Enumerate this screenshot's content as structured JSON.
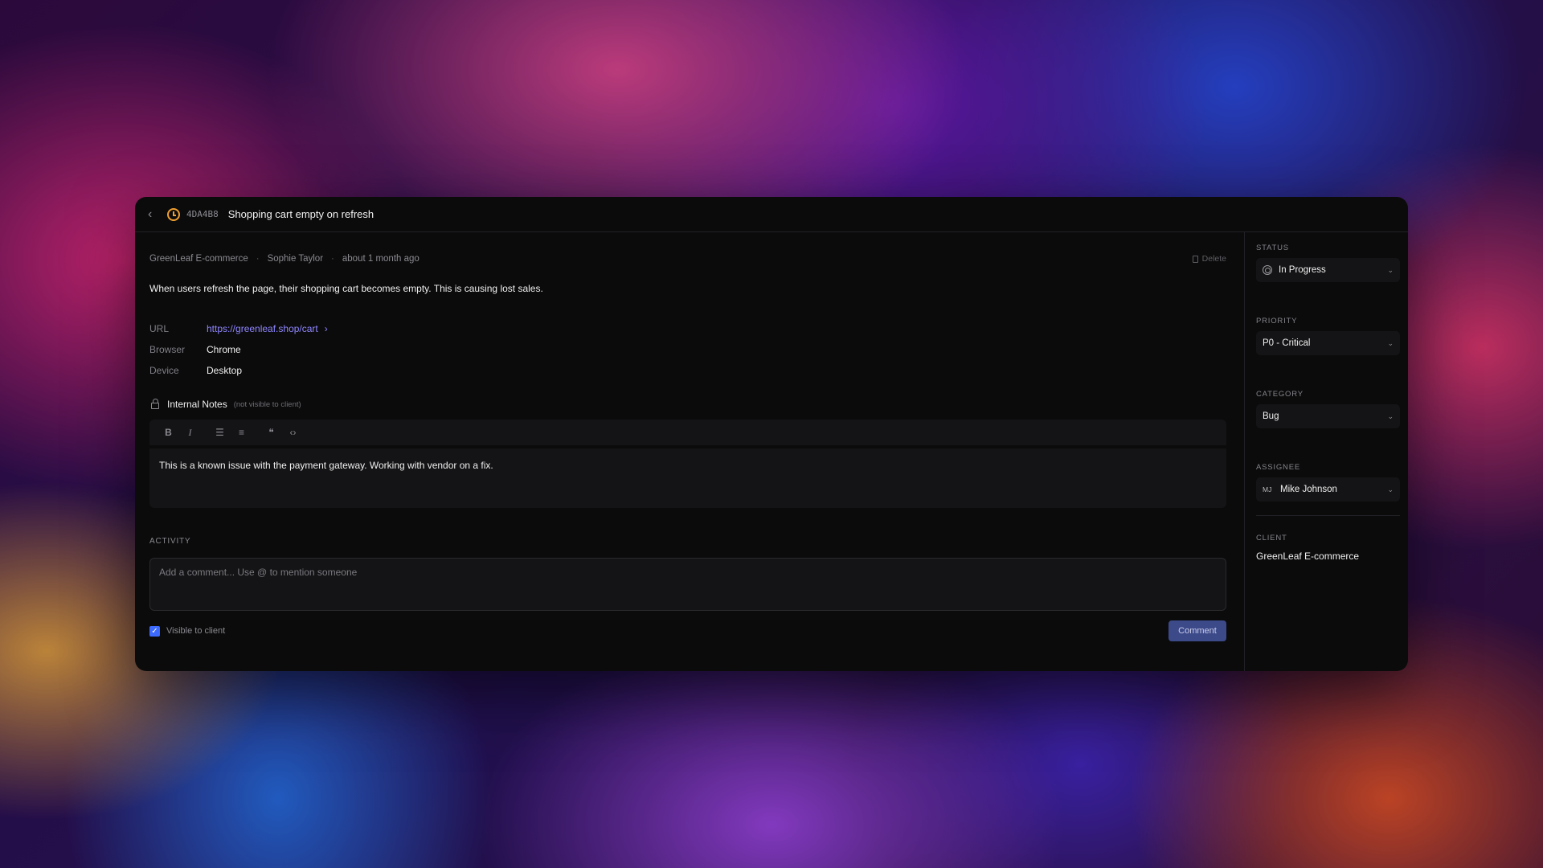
{
  "header": {
    "ticket_id": "4DA4B8",
    "title": "Shopping cart empty on refresh"
  },
  "meta": {
    "client": "GreenLeaf E-commerce",
    "author": "Sophie Taylor",
    "time": "about 1 month ago",
    "delete_label": "Delete"
  },
  "description": "When users refresh the page, their shopping cart becomes empty. This is causing lost sales.",
  "properties": [
    {
      "key": "URL",
      "value": "https://greenleaf.shop/cart"
    },
    {
      "key": "Browser",
      "value": "Chrome"
    },
    {
      "key": "Device",
      "value": "Desktop"
    }
  ],
  "notes": {
    "title": "Internal Notes",
    "subtitle": "(not visible to client)",
    "content": "This is a known issue with the payment gateway. Working with vendor on a fix."
  },
  "activity": {
    "label": "ACTIVITY",
    "comment_placeholder": "Add a comment... Use @ to mention someone",
    "visible_label": "Visible to client",
    "comment_button": "Comment"
  },
  "sidebar": {
    "status_label": "STATUS",
    "status_value": "In Progress",
    "priority_label": "PRIORITY",
    "priority_value": "P0 - Critical",
    "category_label": "CATEGORY",
    "category_value": "Bug",
    "assignee_label": "ASSIGNEE",
    "assignee_initials": "MJ",
    "assignee_value": "Mike Johnson",
    "client_label": "CLIENT",
    "client_value": "GreenLeaf E-commerce"
  },
  "colors": {
    "accent": "#8f86ff",
    "status_icon": "#f0a030",
    "checkbox": "#3d6bff",
    "button": "#3c4a8a"
  }
}
